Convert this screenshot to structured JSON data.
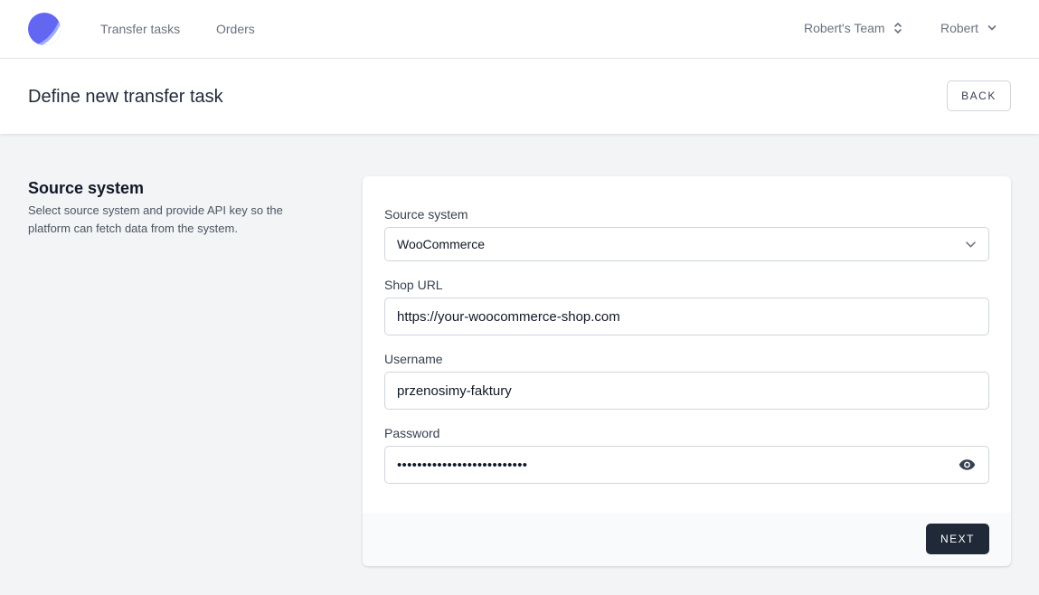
{
  "nav": {
    "links": [
      "Transfer tasks",
      "Orders"
    ],
    "team": "Robert's Team",
    "user": "Robert"
  },
  "header": {
    "title": "Define new transfer task",
    "back_label": "BACK"
  },
  "section": {
    "title": "Source system",
    "description": "Select source system and provide API key so the platform can fetch data from the system."
  },
  "form": {
    "source_system": {
      "label": "Source system",
      "value": "WooCommerce"
    },
    "shop_url": {
      "label": "Shop URL",
      "value": "https://your-woocommerce-shop.com"
    },
    "username": {
      "label": "Username",
      "value": "przenosimy-faktury"
    },
    "password": {
      "label": "Password",
      "masked_value": "••••••••••••••••••••••••••"
    },
    "next_label": "NEXT"
  },
  "colors": {
    "brand": "#6366f1",
    "primary_button": "#1f2937",
    "page_background": "#f3f4f6"
  },
  "icons": {
    "logo": "logo-icon",
    "team_switch": "chevron-up-down-icon",
    "user_menu": "chevron-down-icon",
    "select": "chevron-down-icon",
    "password_toggle": "eye-icon"
  }
}
